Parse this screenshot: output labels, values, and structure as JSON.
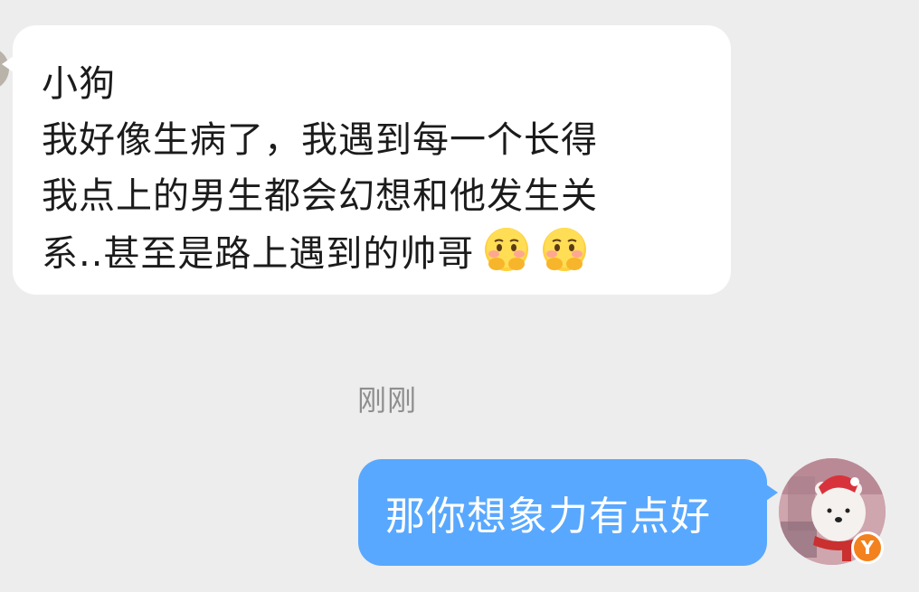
{
  "incoming": {
    "lines": [
      "小狗",
      "我好像生病了，我遇到每一个长得",
      "我点上的男生都会幻想和他发生关",
      "系..甚至是路上遇到的帅哥"
    ],
    "emoji": [
      "shy-emoji",
      "shy-emoji"
    ]
  },
  "timestamp": "刚刚",
  "outgoing": {
    "text": "那你想象力有点好"
  },
  "avatar": {
    "badge": "Y"
  },
  "colors": {
    "background": "#ededed",
    "incoming_bubble": "#ffffff",
    "outgoing_bubble": "#58a8ff",
    "badge": "#f3811e"
  }
}
